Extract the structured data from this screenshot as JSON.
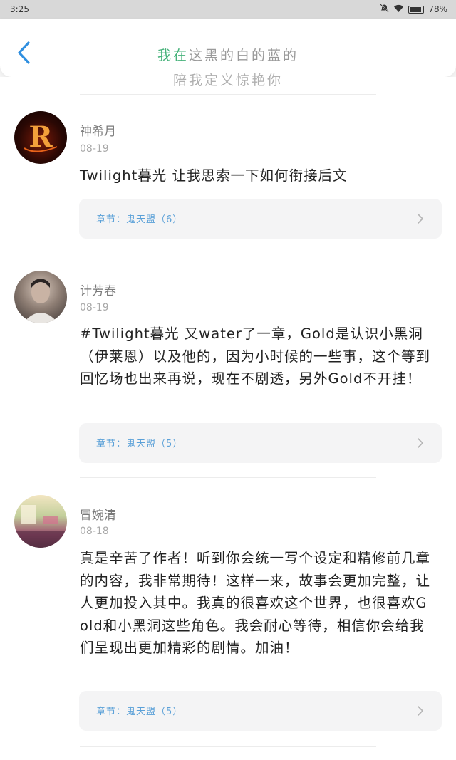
{
  "status": {
    "time": "3:25",
    "battery": "78%"
  },
  "header": {
    "title_green": "我在",
    "title_rest": "这黑的白的蓝的",
    "title_line2": "陪我定义惊艳你"
  },
  "comments": [
    {
      "name": "神希月",
      "date": "08-19",
      "text": "Twilight暮光 让我思索一下如何衔接后文",
      "chapter": "章节：鬼天盟（6）"
    },
    {
      "name": "计芳春",
      "date": "08-19",
      "text": "#Twilight暮光 又water了一章，Gold是认识小黑洞（伊莱恩）以及他的，因为小时候的一些事，这个等到回忆场也出来再说，现在不剧透，另外Gold不开挂！",
      "chapter": "章节：鬼天盟（5）"
    },
    {
      "name": "冒婉清",
      "date": "08-18",
      "text": "真是辛苦了作者！听到你会统一写个设定和精修前几章的内容，我非常期待！这样一来，故事会更加完整，让人更加投入其中。我真的很喜欢这个世界，也很喜欢Gold和小黑洞这些角色。我会耐心等待，相信你会给我们呈现出更加精彩的剧情。加油！",
      "chapter": "章节：鬼天盟（5）"
    }
  ],
  "colors": {
    "accent_blue": "#2f8fe0",
    "chapter_blue": "#5aa0d8",
    "title_green": "#46b27a"
  },
  "icons": {
    "back": "chevron-left-icon",
    "chapter_arrow": "chevron-right-icon",
    "mute": "bell-off-icon",
    "wifi": "wifi-icon",
    "battery": "battery-icon"
  }
}
